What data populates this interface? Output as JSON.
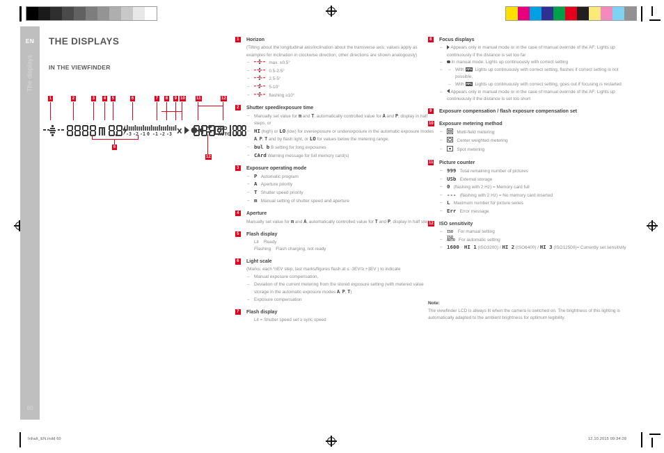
{
  "print_marks": {
    "grey_bar": [
      "#000000",
      "#1a1a1a",
      "#2f2f2f",
      "#4a4a4a",
      "#616161",
      "#7d7d7d",
      "#949494",
      "#aeaeae",
      "#c8c8c8",
      "#e8e8e8",
      "#ffffff"
    ],
    "color_bar": [
      "#ffe000",
      "#e6007e",
      "#00a0e3",
      "#2e3191",
      "#00a04a",
      "#e2001a",
      "#231f20",
      "#faea7a",
      "#f489bd",
      "#7fd3f2",
      "#929292"
    ]
  },
  "sidebar": {
    "language": "EN",
    "chapter": "The displays",
    "page_number": "60"
  },
  "header": {
    "title": "THE DISPLAYS",
    "section": "IN THE VIEWFINDER"
  },
  "figure": {
    "name": "viewfinder-lcd-diagram",
    "callouts_top": [
      "1",
      "2",
      "3",
      "4",
      "5",
      "6",
      "7",
      "8",
      "9",
      "10",
      "11",
      "12"
    ],
    "callouts_bottom": [
      "6",
      "12"
    ],
    "lcd_segments": {
      "horizon": "-|-",
      "shutter_speed": "8888",
      "exposure_mode": "m",
      "aperture": "8.8",
      "flash": "flash-bolt",
      "light_scale": "-3 -2 -1 0 1 2 3",
      "sync": "X",
      "focus_left": "triangle-right",
      "focus_center": "dot",
      "focus_right": "triangle-left",
      "exposure_comp": "+/-",
      "metering": "multi-field-icon",
      "picture_counter": "888",
      "iso_label": "ISO AUTO",
      "iso_value": "1888"
    }
  },
  "items": [
    {
      "num": "1",
      "title": "Horizon",
      "paragraph": "(Tilting about the longitudinal axis/inclination about the transverse axis; values apply as examples for inclination in clockwise direction; other directions are shown analogously)",
      "rows": [
        {
          "icon": "horizon-level-0",
          "text": "max. ±0.5°"
        },
        {
          "icon": "horizon-level-1",
          "text": "0.5-2.5°"
        },
        {
          "icon": "horizon-level-2",
          "text": "2.5-5°"
        },
        {
          "icon": "horizon-level-3",
          "text": "5-10°"
        },
        {
          "icon": "horizon-level-4",
          "text": "flashing ≥10°"
        }
      ]
    },
    {
      "num": "2",
      "title": "Shutter speed/exposure time",
      "bullets": [
        "Manually set value for <span class=\"seg\">m</span> and <span class=\"seg\">T</span>, automatically controlled value for <span class=\"seg\">A</span> and <span class=\"seg\">P</span>, display in half steps, or",
        "<span class=\"seg-b\">HI</span> (high) or <span class=\"seg-b\">LO</span> (low) for overexposure or underexposure in the automatic exposure modes <span class=\"seg\">A</span>, <span class=\"seg\">P</span>, <span class=\"seg\">T</span> and by flash light, or <span class=\"seg-b\">LO</span> for values below the metering range.",
        "<span class=\"seg-b\">bul b</span> B setting for long exposures",
        "<span class=\"seg-b\">CArd</span> Warning message for full memory card(s)"
      ]
    },
    {
      "num": "3",
      "title": "Exposure operating mode",
      "rows": [
        {
          "icon": "P",
          "text": "Automatic program"
        },
        {
          "icon": "A",
          "text": "Aperture priority"
        },
        {
          "icon": "T",
          "text": "Shutter speed priority"
        },
        {
          "icon": "m",
          "text": "Manual setting of shutter speed and aperture"
        }
      ]
    },
    {
      "num": "4",
      "title": "Aperture",
      "paragraph": "Manually set value for <span class=\"seg\">m</span> and <span class=\"seg\">A</span>, automatically controlled value for <span class=\"seg\">T</span> and <span class=\"seg\">P</span>; display in half steps"
    },
    {
      "num": "5",
      "title": "Flash display",
      "lines": [
        "Lit&nbsp;&nbsp;&nbsp;&nbsp;Ready",
        "Flashing&nbsp;&nbsp;&nbsp;&nbsp;Flash charging, not ready"
      ]
    },
    {
      "num": "6",
      "title": "Light scale",
      "paragraph": "(Marks: each ½EV step, last marks/figures flash at ≤ -3EV/≥ +3EV ) to indicate",
      "bullets": [
        "Manual exposure compensation,",
        "Deviation of the current metering from the stored exposure setting (with metered value storage in the automatic exposure modes <span class=\"seg\">A</span>, <span class=\"seg\">P</span>, <span class=\"seg\">T</span>)",
        "Exposure compensation"
      ]
    },
    {
      "num": "7",
      "title": "Flash display",
      "lines": [
        "Lit = Shutter speed set ≥ sync speed"
      ]
    }
  ],
  "items2": [
    {
      "num": "8",
      "title": "Focus displays",
      "bullets": [
        "<span class=\"tri-r\"></span> Appears only in manual mode or in the case of manual override of the AF: Lights up continuously if the distance is set too far",
        "<span class=\"dotc\"></span> In manual mode: Lights up continuously with correct setting"
      ],
      "subbullets": [
        "With <span class=\"afbadge\">AFs</span>: Lights up continuously with correct setting, flashes if correct setting is not possible,",
        "With <span class=\"afbadge\">AFc</span>: Lights up continuously with correct setting, goes out if focusing is restarted"
      ],
      "bullets_after": [
        "<span class=\"tri-l\"></span> Appears only in manual mode or in the case of manual override of the AF: Lights up continuously if the distance is set too short"
      ]
    },
    {
      "num": "9",
      "title": "Exposure compensation / flash exposure compensation set"
    },
    {
      "num": "10",
      "title": "Exposure metering method",
      "rows": [
        {
          "icon": "multi-field",
          "text": "Multi-field metering"
        },
        {
          "icon": "center-weighted",
          "text": "Center weighted metering"
        },
        {
          "icon": "spot",
          "text": "Spot metering"
        }
      ]
    },
    {
      "num": "11",
      "title": "Picture counter",
      "rows": [
        {
          "icon": "999",
          "text": "Total remaining number of pictures"
        },
        {
          "icon": "USb",
          "text": "External storage"
        },
        {
          "icon": "0",
          "text": "(flashing with 2 Hz) = Memory card full"
        },
        {
          "icon": "---",
          "text": "(flashing with 2 Hz) = No memory card inserted"
        },
        {
          "icon": "L",
          "text": "Maximum number for picture series"
        },
        {
          "icon": "Err",
          "text": "Error message"
        }
      ]
    },
    {
      "num": "12",
      "title": "ISO sensitivity",
      "rows": [
        {
          "icon": "ISO",
          "text": "For manual setting"
        },
        {
          "icon": "ISO-AUTO",
          "text": "For automatic setting"
        }
      ],
      "last_row": {
        "icon": "1600",
        "text": "<span class=\"seg-b\">HI 1</span> (ISO3200) / <span class=\"seg-b\">HI 2</span> (ISO6400) / <span class=\"seg-b\">HI 3</span> (ISO12500)= Currently set sensitivity"
      }
    }
  ],
  "note": {
    "label": "Note:",
    "text": "The viewfinder LCD is always lit when the camera is switched on. The brightness of this lighting is automatically adapted to the ambient brightness for optimum legibility."
  },
  "footer": {
    "left": "Inhalt_EN.indd   60",
    "right": "12.10.2015   09:34:28"
  },
  "colors": {
    "accent_red": "#e2001a",
    "tab_grey": "#bfbfbf",
    "body_text": "#8a8a8a"
  }
}
